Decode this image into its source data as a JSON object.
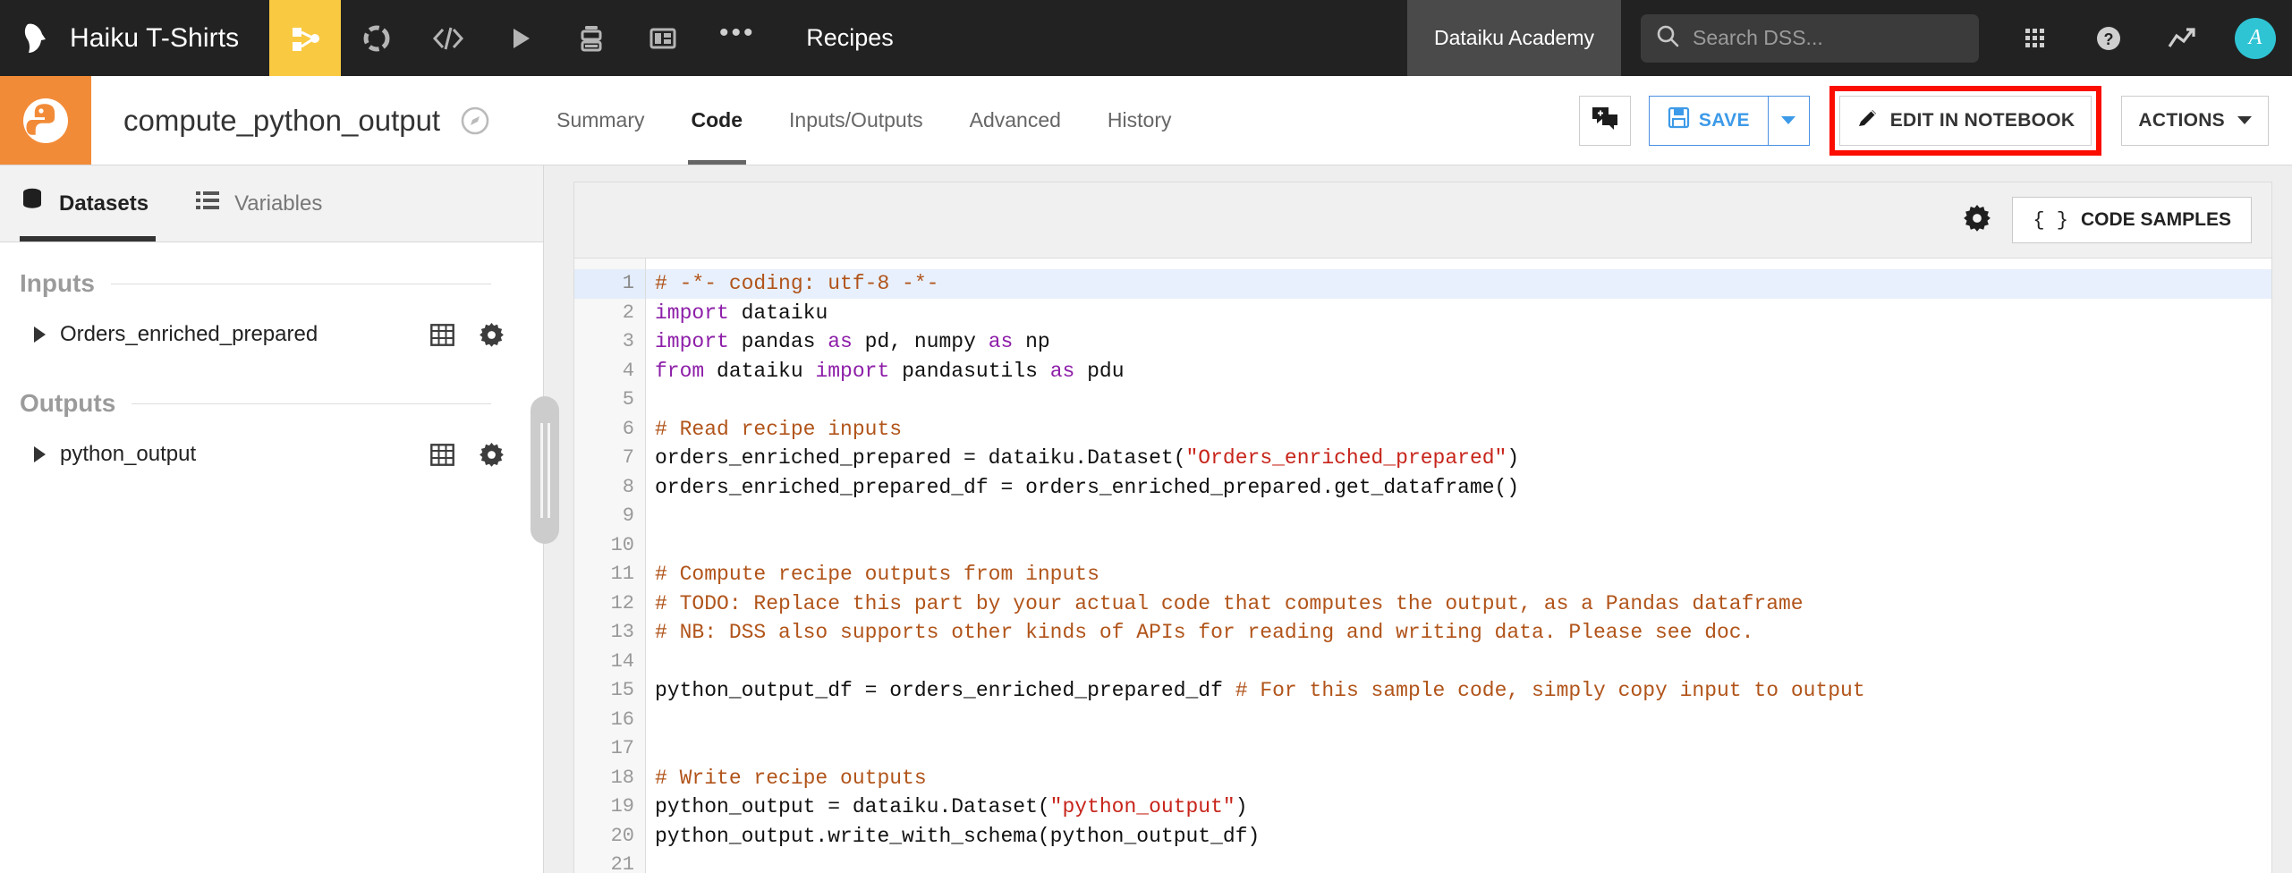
{
  "topnav": {
    "logo_icon": "dataiku-bird-logo",
    "project_name": "Haiku T-Shirts",
    "icons": [
      {
        "name": "flow-icon",
        "active": true
      },
      {
        "name": "lab-icon",
        "active": false
      },
      {
        "name": "code-icon",
        "active": false
      },
      {
        "name": "jobs-play-icon",
        "active": false
      },
      {
        "name": "deploy-stack-icon",
        "active": false
      },
      {
        "name": "dashboard-icon",
        "active": false
      }
    ],
    "more_dots": "•••",
    "section_title": "Recipes",
    "academy_label": "Dataiku Academy",
    "search": {
      "icon": "search-icon",
      "placeholder": "Search DSS...",
      "value": ""
    },
    "right_icons": [
      {
        "name": "apps-grid-icon"
      },
      {
        "name": "help-question-icon"
      },
      {
        "name": "activity-trend-icon"
      }
    ],
    "avatar_initial": "A",
    "accent_yellow": "#f9c941",
    "bar_background": "#222222"
  },
  "recipe": {
    "icon_name": "python-recipe-icon",
    "icon_background": "#f28b38",
    "title": "compute_python_output",
    "badge_icon": "zone-compass-icon",
    "tabs": [
      {
        "label": "Summary",
        "active": false
      },
      {
        "label": "Code",
        "active": true
      },
      {
        "label": "Inputs/Outputs",
        "active": false
      },
      {
        "label": "Advanced",
        "active": false
      },
      {
        "label": "History",
        "active": false
      }
    ],
    "buttons": {
      "discussions_icon": "discussions-icon",
      "save_label": "SAVE",
      "save_icon": "floppy-disk-icon",
      "save_caret_icon": "chevron-down-icon",
      "notebook_label": "EDIT IN NOTEBOOK",
      "notebook_icon": "pencil-icon",
      "actions_label": "ACTIONS",
      "actions_caret_icon": "chevron-down-icon",
      "highlight_color": "#fb0d00"
    }
  },
  "sidebar": {
    "tabs": [
      {
        "label": "Datasets",
        "icon": "database-icon",
        "active": true
      },
      {
        "label": "Variables",
        "icon": "list-icon",
        "active": false
      }
    ],
    "sections": [
      {
        "title": "Inputs",
        "items": [
          {
            "name": "Orders_enriched_prepared",
            "caret_icon": "caret-right-icon",
            "table_icon": "table-grid-icon",
            "gear_icon": "gear-icon"
          }
        ]
      },
      {
        "title": "Outputs",
        "items": [
          {
            "name": "python_output",
            "caret_icon": "caret-right-icon",
            "table_icon": "table-grid-icon",
            "gear_icon": "gear-icon"
          }
        ]
      }
    ],
    "splitter_name": "panel-resize-handle"
  },
  "code_panel": {
    "toolbar": {
      "settings_icon": "gear-icon",
      "samples_label": "CODE SAMPLES",
      "samples_braces": "{ }"
    },
    "line_numbers": [
      1,
      2,
      3,
      4,
      5,
      6,
      7,
      8,
      9,
      10,
      11,
      12,
      13,
      14,
      15,
      16,
      17,
      18,
      19,
      20,
      21
    ],
    "active_line": 1,
    "lines": [
      [
        {
          "t": "# -*- coding: utf-8 -*-",
          "c": "cmt"
        }
      ],
      [
        {
          "t": "import",
          "c": "kw"
        },
        {
          "t": " dataiku",
          "c": ""
        }
      ],
      [
        {
          "t": "import",
          "c": "kw"
        },
        {
          "t": " pandas ",
          "c": ""
        },
        {
          "t": "as",
          "c": "kw"
        },
        {
          "t": " pd, numpy ",
          "c": ""
        },
        {
          "t": "as",
          "c": "kw"
        },
        {
          "t": " np",
          "c": ""
        }
      ],
      [
        {
          "t": "from",
          "c": "kw"
        },
        {
          "t": " dataiku ",
          "c": ""
        },
        {
          "t": "import",
          "c": "kw"
        },
        {
          "t": " pandasutils ",
          "c": ""
        },
        {
          "t": "as",
          "c": "kw"
        },
        {
          "t": " pdu",
          "c": ""
        }
      ],
      [],
      [
        {
          "t": "# Read recipe inputs",
          "c": "cmt"
        }
      ],
      [
        {
          "t": "orders_enriched_prepared = dataiku.Dataset(",
          "c": ""
        },
        {
          "t": "\"Orders_enriched_prepared\"",
          "c": "str"
        },
        {
          "t": ")",
          "c": ""
        }
      ],
      [
        {
          "t": "orders_enriched_prepared_df = orders_enriched_prepared.get_dataframe()",
          "c": ""
        }
      ],
      [],
      [],
      [
        {
          "t": "# Compute recipe outputs from inputs",
          "c": "cmt"
        }
      ],
      [
        {
          "t": "# TODO: Replace this part by your actual code that computes the output, as a Pandas dataframe",
          "c": "cmt"
        }
      ],
      [
        {
          "t": "# NB: DSS also supports other kinds of APIs for reading and writing data. Please see doc.",
          "c": "cmt"
        }
      ],
      [],
      [
        {
          "t": "python_output_df = orders_enriched_prepared_df ",
          "c": ""
        },
        {
          "t": "# For this sample code, simply copy input to output",
          "c": "cmt"
        }
      ],
      [],
      [],
      [
        {
          "t": "# Write recipe outputs",
          "c": "cmt"
        }
      ],
      [
        {
          "t": "python_output = dataiku.Dataset(",
          "c": ""
        },
        {
          "t": "\"python_output\"",
          "c": "str"
        },
        {
          "t": ")",
          "c": ""
        }
      ],
      [
        {
          "t": "python_output.write_with_schema(python_output_df)",
          "c": ""
        }
      ],
      []
    ],
    "syntax_colors": {
      "comment": "#b1541a",
      "keyword": "#8d1ea8",
      "string": "#c7241a",
      "text": "#111111",
      "active_line_bg": "#e8f0fd"
    }
  }
}
